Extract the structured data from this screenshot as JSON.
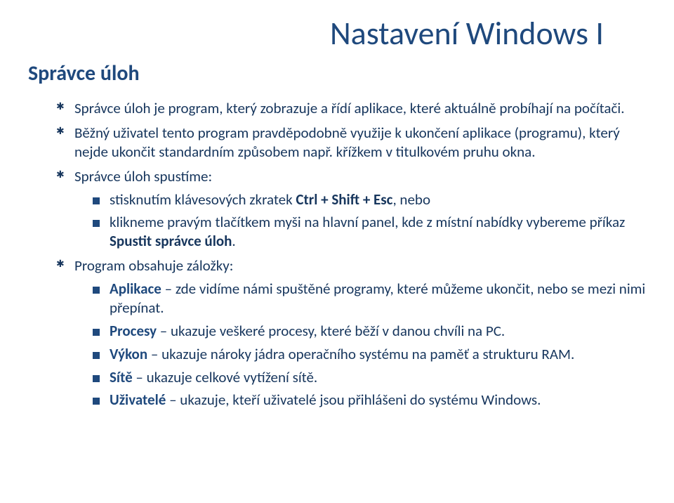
{
  "title": "Nastavení Windows I",
  "subtitle": "Správce úloh",
  "items": [
    {
      "text": "Správce úloh je program, který zobrazuje a řídí aplikace, které aktuálně probíhají na počítači."
    },
    {
      "text": "Běžný uživatel tento program pravděpodobně využije k ukončení aplikace (programu), který nejde ukončit standardním způsobem např. křížkem v titulkovém pruhu okna."
    },
    {
      "text": "Správce úloh spustíme:",
      "sub": [
        {
          "pre": "stisknutím klávesových zkratek ",
          "bold": "Ctrl + Shift + Esc",
          "post": ", nebo"
        },
        {
          "pre": "klikneme pravým tlačítkem myši na hlavní panel, kde z místní nabídky vybereme příkaz ",
          "bold": "Spustit správce úloh",
          "post": "."
        }
      ]
    },
    {
      "text": "Program obsahuje záložky:",
      "sub": [
        {
          "label": "Aplikace",
          "rest": " – zde vidíme námi spuštěné programy, které můžeme ukončit, nebo se mezi nimi přepínat."
        },
        {
          "label": "Procesy",
          "rest": " – ukazuje veškeré procesy, které běží v danou chvíli na PC."
        },
        {
          "label": "Výkon",
          "rest": " – ukazuje nároky jádra operačního systému na paměť a strukturu RAM."
        },
        {
          "label": "Sítě",
          "rest": " – ukazuje celkové vytížení sítě."
        },
        {
          "label": "Uživatelé",
          "rest": " – ukazuje, kteří uživatelé jsou přihlášeni do systému Windows."
        }
      ]
    }
  ]
}
